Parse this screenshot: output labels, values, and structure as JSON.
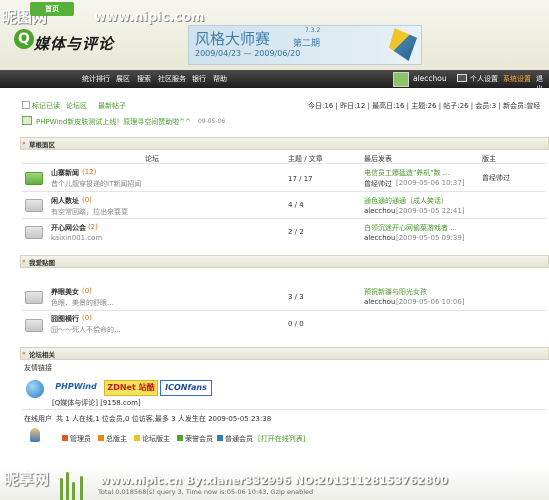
{
  "watermark": {
    "logo": "昵图网",
    "url": "www.nipic.com",
    "bottom_logo": "昵享网",
    "bottom_text": "www.nipic.cn By:xianer332996 NO:20131128153762800"
  },
  "header": {
    "logo_q": "Q",
    "logo_text": "媒体与评论",
    "banner_title": "风格大师赛",
    "banner_sub": "第二期",
    "banner_ver": "7.3.2",
    "banner_date": "2009/04/23 — 2009/06/20"
  },
  "nav": {
    "home": "首页",
    "items": [
      "统计排行",
      "展区",
      "搜索",
      "社区服务",
      "银行",
      "帮助"
    ],
    "username": "alecchou",
    "right_items": [
      "个人设置",
      "系统设置",
      "退出"
    ]
  },
  "toolbar": {
    "links": [
      "标记已读",
      "论坛区",
      "最新帖子"
    ],
    "stats": "今日:16 | 昨日:12 | 最高日:16 | 主题:26 | 帖子:26 | 会员:3 | 新会员:曾经",
    "notice": "PHPWind新皮肤测试上线！原理寻空间赞助啦^^",
    "notice_date": "09-05-06"
  },
  "section1": {
    "title": "草根面区",
    "headers": {
      "forum": "论坛",
      "topics": "主题 / 文章",
      "last": "最后发表",
      "mod": "版主"
    },
    "rows": [
      {
        "name": "山寨新闻",
        "count": "(12)",
        "desc": "昔个儿靓穿投递的IT新闻招闻",
        "stats": "17 / 17",
        "last_title": "电信员工爆猛造\"养机\"数 ...",
        "last_user": "曾经帅过",
        "last_time": "[2009-05-06 10:37]",
        "mod": "曾经帅过"
      },
      {
        "name": "闲人数址",
        "count": "(0)",
        "desc": "有空常回踏，拉出来耍耍",
        "stats": "4 / 4",
        "last_title": "通色通的通通（成人笑话）",
        "last_user": "alecchou",
        "last_time": "[2009-05-05 22:41]",
        "mod": ""
      },
      {
        "name": "开心网公会",
        "count": "(2)",
        "desc": "kaixin001.com",
        "stats": "2 / 2",
        "last_title": "白领沉迷开心网偷菜游戏者 ...",
        "last_user": "alecchou",
        "last_time": "[2009-05-05 09:39]",
        "mod": ""
      }
    ]
  },
  "section2": {
    "title": "我爱贴图",
    "rows": [
      {
        "name": "养眼美女",
        "count": "(0)",
        "desc": "色眼、美景的舒眼...",
        "stats": "3 / 3",
        "last_title": "预祝新疆与阳光女孩",
        "last_user": "alecchou",
        "last_time": "[2009-05-06 10:06]"
      },
      {
        "name": "囧图横行",
        "count": "(0)",
        "desc": "囧～～死人不偿命的...",
        "stats": "0 / 0",
        "last_title": "",
        "last_user": "",
        "last_time": ""
      }
    ]
  },
  "section3": {
    "title": "论坛相关",
    "friend_links": "友情链接",
    "logos": [
      "PHPWind",
      "ZDNet 站酷",
      "ICONfans"
    ],
    "link_text": "[Q媒体与评论] [9158.com]",
    "online_label": "在线用户",
    "online_text": "共 1 人在线,1 位会员,0 位访客,最多 3 人发生在 2009-05-05 23:38",
    "legend": [
      "管理员",
      "总版主",
      "论坛版主",
      "荣誉会员",
      "普通会员"
    ],
    "legend_link": "[打开在线列表]"
  },
  "footer": {
    "info": "Total 0.018568(s) query 3, Time now is:05-06 10:43, Gzip enabled"
  },
  "colors": {
    "green": "#4a9a2a",
    "orange": "#e26a10",
    "nav_bg": "#2a2a2a",
    "home_btn": "#55b13a"
  }
}
